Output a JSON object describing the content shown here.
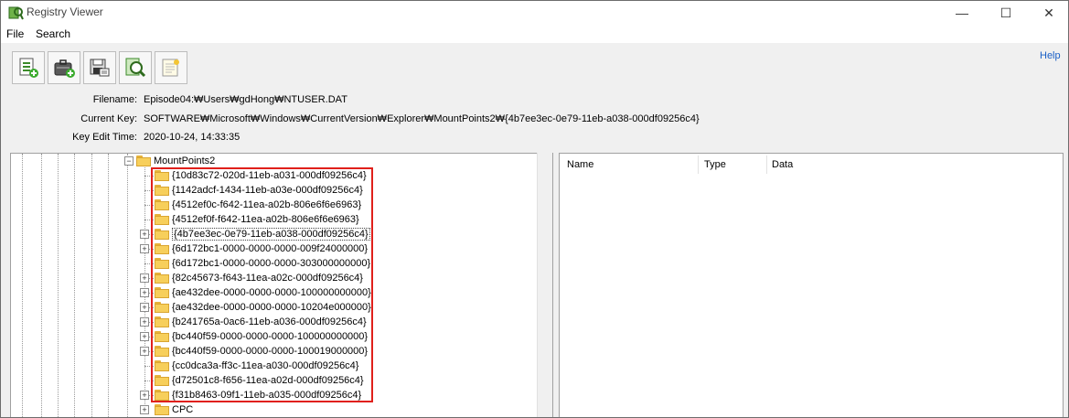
{
  "window": {
    "title": "Registry Viewer",
    "controls": {
      "minimize": "—",
      "maximize": "☐",
      "close": "✕"
    }
  },
  "menu": {
    "items": [
      "File",
      "Search"
    ]
  },
  "toolbar": {
    "buttons": [
      "new-hive-icon",
      "open-case-icon",
      "save-report-icon",
      "search-key-icon",
      "notes-icon"
    ],
    "help_label": "Help"
  },
  "info": {
    "filename_label": "Filename:",
    "filename_value": "Episode04:₩Users₩gdHong₩NTUSER.DAT",
    "current_key_label": "Current Key:",
    "current_key_value": "SOFTWARE₩Microsoft₩Windows₩CurrentVersion₩Explorer₩MountPoints2₩{4b7ee3ec-0e79-11eb-a038-000df09256c4}",
    "edit_time_label": "Key Edit Time:",
    "edit_time_value": "2020-10-24, 14:33:35"
  },
  "tree": {
    "parent": "MountPoints2",
    "children": [
      {
        "label": "{10d83c72-020d-11eb-a031-000df09256c4}",
        "expandable": false
      },
      {
        "label": "{1142adcf-1434-11eb-a03e-000df09256c4}",
        "expandable": false
      },
      {
        "label": "{4512ef0c-f642-11ea-a02b-806e6f6e6963}",
        "expandable": false
      },
      {
        "label": "{4512ef0f-f642-11ea-a02b-806e6f6e6963}",
        "expandable": false
      },
      {
        "label": "{4b7ee3ec-0e79-11eb-a038-000df09256c4}",
        "expandable": true,
        "selected": true
      },
      {
        "label": "{6d172bc1-0000-0000-0000-009f24000000}",
        "expandable": true
      },
      {
        "label": "{6d172bc1-0000-0000-0000-303000000000}",
        "expandable": false
      },
      {
        "label": "{82c45673-f643-11ea-a02c-000df09256c4}",
        "expandable": true
      },
      {
        "label": "{ae432dee-0000-0000-0000-100000000000}",
        "expandable": true
      },
      {
        "label": "{ae432dee-0000-0000-0000-10204e000000}",
        "expandable": true
      },
      {
        "label": "{b241765a-0ac6-11eb-a036-000df09256c4}",
        "expandable": true
      },
      {
        "label": "{bc440f59-0000-0000-0000-100000000000}",
        "expandable": true
      },
      {
        "label": "{bc440f59-0000-0000-0000-100019000000}",
        "expandable": true
      },
      {
        "label": "{cc0dca3a-ff3c-11ea-a030-000df09256c4}",
        "expandable": false
      },
      {
        "label": "{d72501c8-f656-11ea-a02d-000df09256c4}",
        "expandable": false
      },
      {
        "label": "{f31b8463-09f1-11eb-a035-000df09256c4}",
        "expandable": true
      }
    ],
    "next_sibling": "CPC"
  },
  "details": {
    "columns": [
      "Name",
      "Type",
      "Data"
    ]
  },
  "colors": {
    "highlight": "#e0201b",
    "folder": "#f7cf5b",
    "link": "#1a5fc6"
  }
}
